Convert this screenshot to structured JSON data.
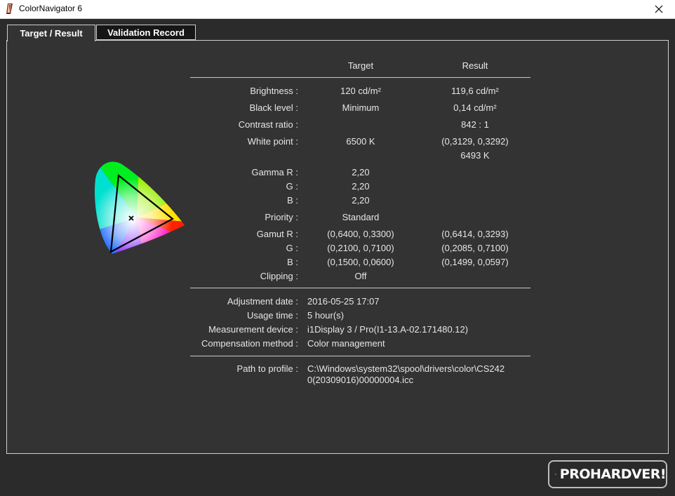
{
  "window": {
    "title": "ColorNavigator 6"
  },
  "tabs": [
    {
      "label": "Target / Result",
      "active": true
    },
    {
      "label": "Validation Record",
      "active": false
    }
  ],
  "columns": {
    "target": "Target",
    "result": "Result"
  },
  "rows": {
    "brightness": {
      "label": "Brightness :",
      "target": "120 cd/m²",
      "result": "119,6 cd/m²"
    },
    "black_level": {
      "label": "Black level :",
      "target": "Minimum",
      "result": "0,14 cd/m²"
    },
    "contrast": {
      "label": "Contrast ratio :",
      "target": "",
      "result": "842 : 1"
    },
    "white_point": {
      "label": "White point :",
      "target": "6500 K",
      "result": "(0,3129, 0,3292)",
      "result2": "6493 K"
    },
    "gamma_r": {
      "label": "Gamma R :",
      "target": "2,20"
    },
    "gamma_g": {
      "label": "G :",
      "target": "2,20"
    },
    "gamma_b": {
      "label": "B :",
      "target": "2,20"
    },
    "priority": {
      "label": "Priority :",
      "target": "Standard"
    },
    "gamut_r": {
      "label": "Gamut R :",
      "target": "(0,6400, 0,3300)",
      "result": "(0,6414, 0,3293)"
    },
    "gamut_g": {
      "label": "G :",
      "target": "(0,2100, 0,7100)",
      "result": "(0,2085, 0,7100)"
    },
    "gamut_b": {
      "label": "B :",
      "target": "(0,1500, 0,0600)",
      "result": "(0,1499, 0,0597)"
    },
    "clipping": {
      "label": "Clipping :",
      "target": "Off"
    }
  },
  "info": {
    "adjustment_date": {
      "label": "Adjustment date :",
      "value": "2016-05-25 17:07"
    },
    "usage_time": {
      "label": "Usage time :",
      "value": "5 hour(s)"
    },
    "measurement_device": {
      "label": "Measurement device :",
      "value": "i1Display 3 / Pro(I1-13.A-02.171480.12)"
    },
    "compensation_method": {
      "label": "Compensation method :",
      "value": "Color management"
    },
    "profile_path": {
      "label": "Path to profile :",
      "line1": "C:\\Windows\\system32\\spool\\drivers\\color\\CS242",
      "line2": "0(20309016)00000004.icc"
    }
  },
  "watermark": {
    "text": "PROHARDVER!"
  },
  "icons": {
    "app": "app-icon",
    "close": "close-icon",
    "gamut": "cie-gamut-diagram",
    "watermark": "prohardver-logo-icon"
  }
}
